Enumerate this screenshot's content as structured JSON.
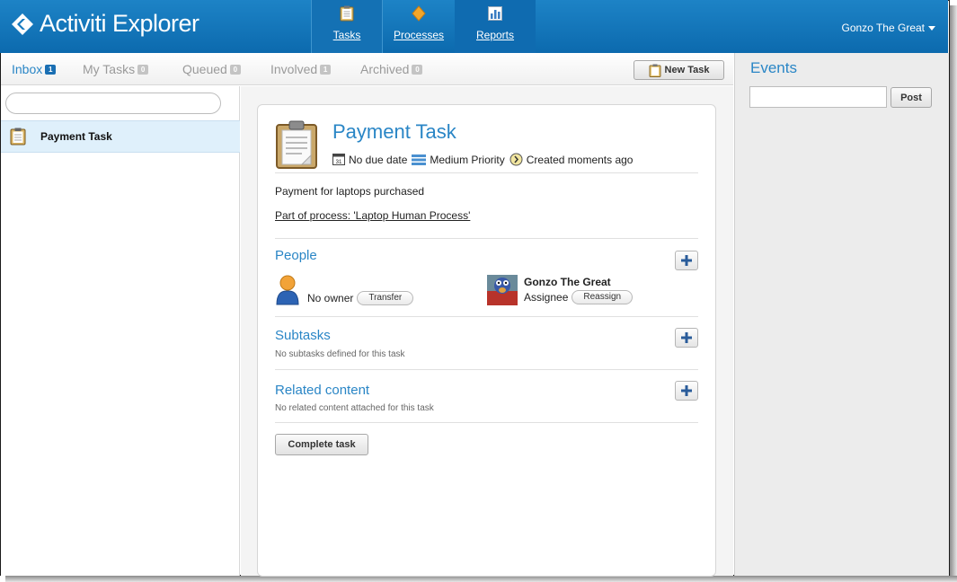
{
  "app": {
    "title": "Activiti Explorer"
  },
  "nav": {
    "items": [
      {
        "label": "Tasks",
        "icon": "clipboard-icon"
      },
      {
        "label": "Processes",
        "icon": "diamond-icon"
      },
      {
        "label": "Reports",
        "icon": "bar-chart-icon"
      }
    ]
  },
  "user": {
    "name": "Gonzo The Great"
  },
  "tabs": [
    {
      "label": "Inbox",
      "count": "1"
    },
    {
      "label": "My Tasks",
      "count": "0"
    },
    {
      "label": "Queued",
      "count": "0"
    },
    {
      "label": "Involved",
      "count": "1"
    },
    {
      "label": "Archived",
      "count": "0"
    }
  ],
  "toolbar": {
    "new_task_label": "New Task"
  },
  "task_list": {
    "search_value": "",
    "items": [
      {
        "label": "Payment Task"
      }
    ]
  },
  "task": {
    "title": "Payment Task",
    "due": "No due date",
    "priority": "Medium Priority",
    "created": "Created moments ago",
    "description": "Payment for laptops purchased",
    "process_link": "Part of process: 'Laptop Human Process'"
  },
  "people": {
    "title": "People",
    "owner_text": "No owner",
    "transfer_label": "Transfer",
    "assignee_name": "Gonzo The Great",
    "assignee_role": "Assignee",
    "reassign_label": "Reassign"
  },
  "subtasks": {
    "title": "Subtasks",
    "note": "No subtasks defined for this task"
  },
  "related": {
    "title": "Related content",
    "note": "No related content attached for this task"
  },
  "complete_label": "Complete task",
  "events": {
    "title": "Events",
    "input_value": "",
    "post_label": "Post"
  },
  "colors": {
    "header": "#1478be",
    "accent": "#2a86c6",
    "selected_row": "#dff0fb"
  }
}
